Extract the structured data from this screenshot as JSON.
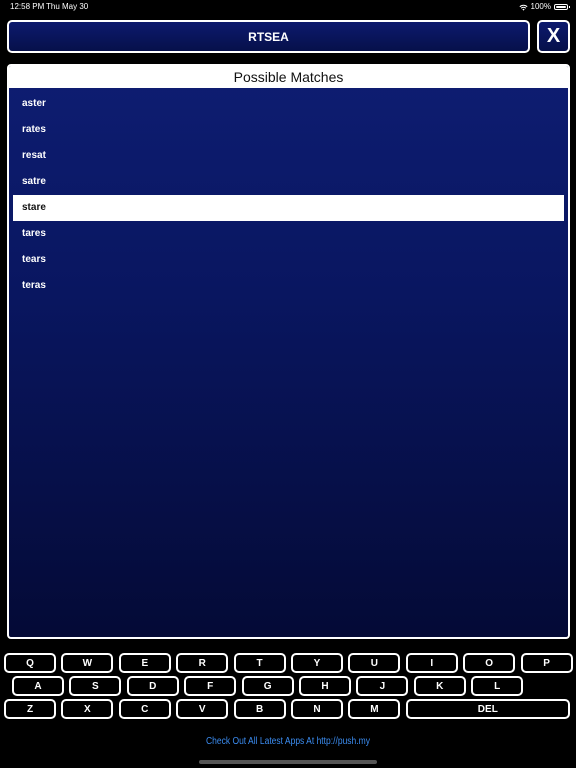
{
  "status_bar": {
    "time": "12:58 PM",
    "date": "Thu May 30",
    "battery": "100%"
  },
  "word_field": {
    "value": "RTSEA"
  },
  "clear_button": {
    "label": "X"
  },
  "matches": {
    "header": "Possible Matches",
    "items": [
      "aster",
      "rates",
      "resat",
      "satre",
      "stare",
      "tares",
      "tears",
      "teras"
    ],
    "selected": "stare"
  },
  "keyboard": {
    "row1": [
      "Q",
      "W",
      "E",
      "R",
      "T",
      "Y",
      "U",
      "I",
      "O",
      "P"
    ],
    "row2": [
      "A",
      "S",
      "D",
      "F",
      "G",
      "H",
      "J",
      "K",
      "L"
    ],
    "row3": [
      "Z",
      "X",
      "C",
      "V",
      "B",
      "N",
      "M",
      "DEL"
    ]
  },
  "footer": {
    "link_text": "Check Out All Latest Apps At http://push.my"
  }
}
